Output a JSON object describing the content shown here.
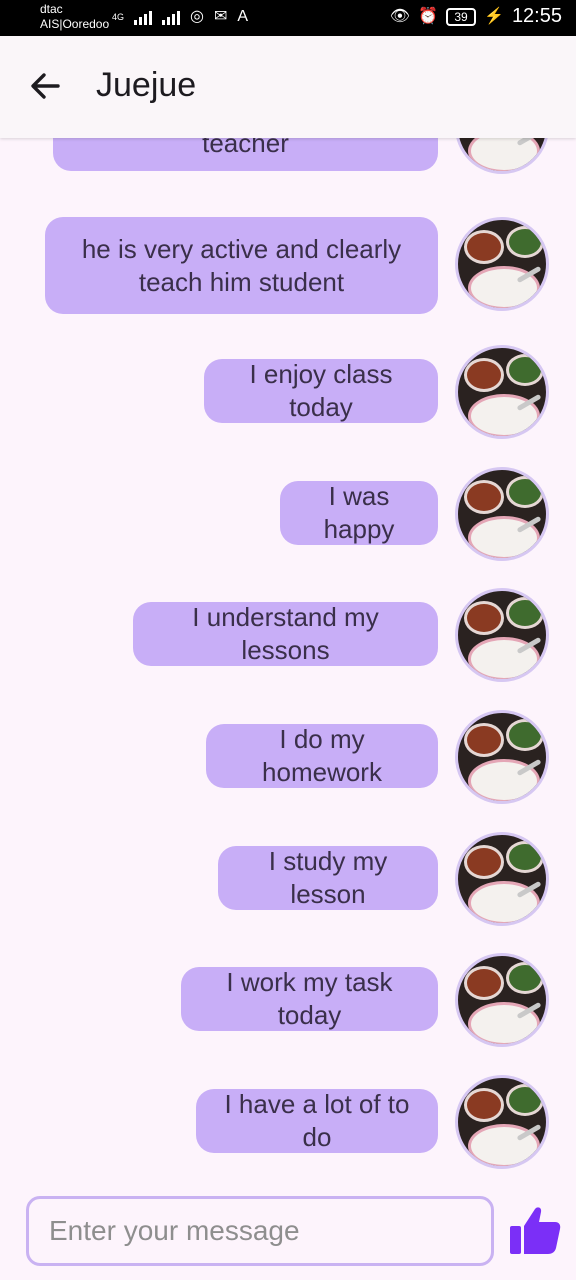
{
  "status": {
    "carrier_1": "dtac",
    "carrier_2": "AIS|Ooredoo",
    "network": "4G",
    "battery": "39",
    "time": "12:55"
  },
  "header": {
    "back_icon": "arrow-left-icon",
    "title": "Juejue"
  },
  "messages": [
    {
      "text": "I'm very pleasant for my teacher"
    },
    {
      "text": "he is very active and clearly teach him student"
    },
    {
      "text": "I enjoy class today"
    },
    {
      "text": "I was happy"
    },
    {
      "text": "I understand my lessons"
    },
    {
      "text": "I do my homework"
    },
    {
      "text": "I study my lesson"
    },
    {
      "text": "I work my task today"
    },
    {
      "text": "I have a lot of to do"
    }
  ],
  "composer": {
    "placeholder": "Enter your message",
    "send_icon": "thumbs-up-icon"
  },
  "colors": {
    "bubble": "#c8aef7",
    "accent": "#7b2ff7",
    "background": "#fdf4fc"
  }
}
